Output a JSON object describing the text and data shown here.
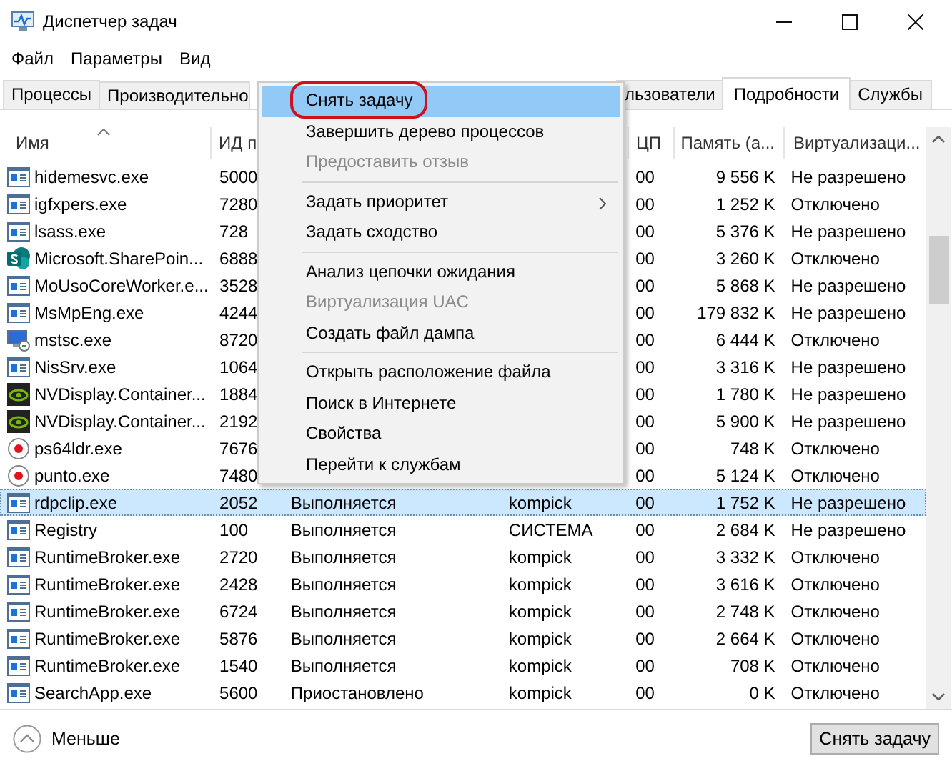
{
  "window": {
    "title": "Диспетчер задач"
  },
  "menu_bar": [
    "Файл",
    "Параметры",
    "Вид"
  ],
  "tabs": [
    {
      "label": "Процессы",
      "selected": false
    },
    {
      "label": "Производительно",
      "selected": false
    },
    {
      "label": "льзователи",
      "selected": false
    },
    {
      "label": "Подробности",
      "selected": true
    },
    {
      "label": "Службы",
      "selected": false
    }
  ],
  "table": {
    "columns": {
      "name": "Имя",
      "pid": "ИД п",
      "cpu": "ЦП",
      "memory": "Память (а...",
      "virtualization": "Виртуализаци..."
    },
    "rows": [
      {
        "kind": "window",
        "name": "hidemesvc.exe",
        "pid": "5000",
        "cpu": "00",
        "memory": "9 556 K",
        "virtualization": "Не разрешено",
        "selected": false
      },
      {
        "kind": "window",
        "name": "igfxpers.exe",
        "pid": "7280",
        "cpu": "00",
        "memory": "1 252 K",
        "virtualization": "Отключено",
        "selected": false
      },
      {
        "kind": "window",
        "name": "lsass.exe",
        "pid": "728",
        "cpu": "00",
        "memory": "5 376 K",
        "virtualization": "Не разрешено",
        "selected": false
      },
      {
        "kind": "sharepoint",
        "name": "Microsoft.SharePoin...",
        "pid": "6888",
        "cpu": "00",
        "memory": "3 260 K",
        "virtualization": "Отключено",
        "selected": false
      },
      {
        "kind": "window",
        "name": "MoUsoCoreWorker.e...",
        "pid": "3528",
        "cpu": "00",
        "memory": "5 868 K",
        "virtualization": "Не разрешено",
        "selected": false
      },
      {
        "kind": "window",
        "name": "MsMpEng.exe",
        "pid": "4244",
        "cpu": "00",
        "memory": "179 832 K",
        "virtualization": "Не разрешено",
        "selected": false
      },
      {
        "kind": "remote",
        "name": "mstsc.exe",
        "pid": "8720",
        "cpu": "00",
        "memory": "6 444 K",
        "virtualization": "Отключено",
        "selected": false
      },
      {
        "kind": "window",
        "name": "NisSrv.exe",
        "pid": "1064",
        "cpu": "00",
        "memory": "3 316 K",
        "virtualization": "Не разрешено",
        "selected": false
      },
      {
        "kind": "nvidia",
        "name": "NVDisplay.Container...",
        "pid": "1884",
        "cpu": "00",
        "memory": "1 780 K",
        "virtualization": "Не разрешено",
        "selected": false
      },
      {
        "kind": "nvidia",
        "name": "NVDisplay.Container...",
        "pid": "2192",
        "cpu": "00",
        "memory": "5 900 K",
        "virtualization": "Не разрешено",
        "selected": false
      },
      {
        "kind": "record",
        "name": "ps64ldr.exe",
        "pid": "7676",
        "cpu": "00",
        "memory": "748 K",
        "virtualization": "Отключено",
        "selected": false
      },
      {
        "kind": "record",
        "name": "punto.exe",
        "pid": "7480",
        "cpu": "00",
        "memory": "5 124 K",
        "virtualization": "Отключено",
        "selected": false
      },
      {
        "kind": "window",
        "name": "rdpclip.exe",
        "pid": "2052",
        "status": "Выполняется",
        "user": "kompick",
        "cpu": "00",
        "memory": "1 752 K",
        "virtualization": "Не разрешено",
        "selected": true
      },
      {
        "kind": "window",
        "name": "Registry",
        "pid": "100",
        "status": "Выполняется",
        "user": "СИСТЕМА",
        "cpu": "00",
        "memory": "2 684 K",
        "virtualization": "Не разрешено",
        "selected": false
      },
      {
        "kind": "window",
        "name": "RuntimeBroker.exe",
        "pid": "2720",
        "status": "Выполняется",
        "user": "kompick",
        "cpu": "00",
        "memory": "3 332 K",
        "virtualization": "Отключено",
        "selected": false
      },
      {
        "kind": "window",
        "name": "RuntimeBroker.exe",
        "pid": "2428",
        "status": "Выполняется",
        "user": "kompick",
        "cpu": "00",
        "memory": "3 616 K",
        "virtualization": "Отключено",
        "selected": false
      },
      {
        "kind": "window",
        "name": "RuntimeBroker.exe",
        "pid": "6724",
        "status": "Выполняется",
        "user": "kompick",
        "cpu": "00",
        "memory": "2 748 K",
        "virtualization": "Отключено",
        "selected": false
      },
      {
        "kind": "window",
        "name": "RuntimeBroker.exe",
        "pid": "5876",
        "status": "Выполняется",
        "user": "kompick",
        "cpu": "00",
        "memory": "2 664 K",
        "virtualization": "Отключено",
        "selected": false
      },
      {
        "kind": "window",
        "name": "RuntimeBroker.exe",
        "pid": "1540",
        "status": "Выполняется",
        "user": "kompick",
        "cpu": "00",
        "memory": "708 K",
        "virtualization": "Отключено",
        "selected": false
      },
      {
        "kind": "window",
        "name": "SearchApp.exe",
        "pid": "5600",
        "status": "Приостановлено",
        "user": "kompick",
        "cpu": "00",
        "memory": "0 K",
        "virtualization": "Отключено",
        "selected": false
      }
    ]
  },
  "context_menu": [
    {
      "kind": "item",
      "label": "Снять задачу",
      "selected": true,
      "disabled": false,
      "circled": true
    },
    {
      "kind": "item",
      "label": "Завершить дерево процессов",
      "selected": false,
      "disabled": false
    },
    {
      "kind": "item",
      "label": "Предоставить отзыв",
      "selected": false,
      "disabled": true
    },
    {
      "kind": "separator"
    },
    {
      "kind": "item",
      "label": "Задать приоритет",
      "selected": false,
      "disabled": false,
      "submenu": true
    },
    {
      "kind": "item",
      "label": "Задать сходство",
      "selected": false,
      "disabled": false
    },
    {
      "kind": "separator"
    },
    {
      "kind": "item",
      "label": "Анализ цепочки ожидания",
      "selected": false,
      "disabled": false
    },
    {
      "kind": "item",
      "label": "Виртуализация UAC",
      "selected": false,
      "disabled": true
    },
    {
      "kind": "item",
      "label": "Создать файл дампа",
      "selected": false,
      "disabled": false
    },
    {
      "kind": "separator"
    },
    {
      "kind": "item",
      "label": "Открыть расположение файла",
      "selected": false,
      "disabled": false
    },
    {
      "kind": "item",
      "label": "Поиск в Интернете",
      "selected": false,
      "disabled": false
    },
    {
      "kind": "item",
      "label": "Свойства",
      "selected": false,
      "disabled": false
    },
    {
      "kind": "item",
      "label": "Перейти к службам",
      "selected": false,
      "disabled": false
    }
  ],
  "footer": {
    "less_link": "Меньше",
    "end_task_button": "Снять задачу"
  }
}
